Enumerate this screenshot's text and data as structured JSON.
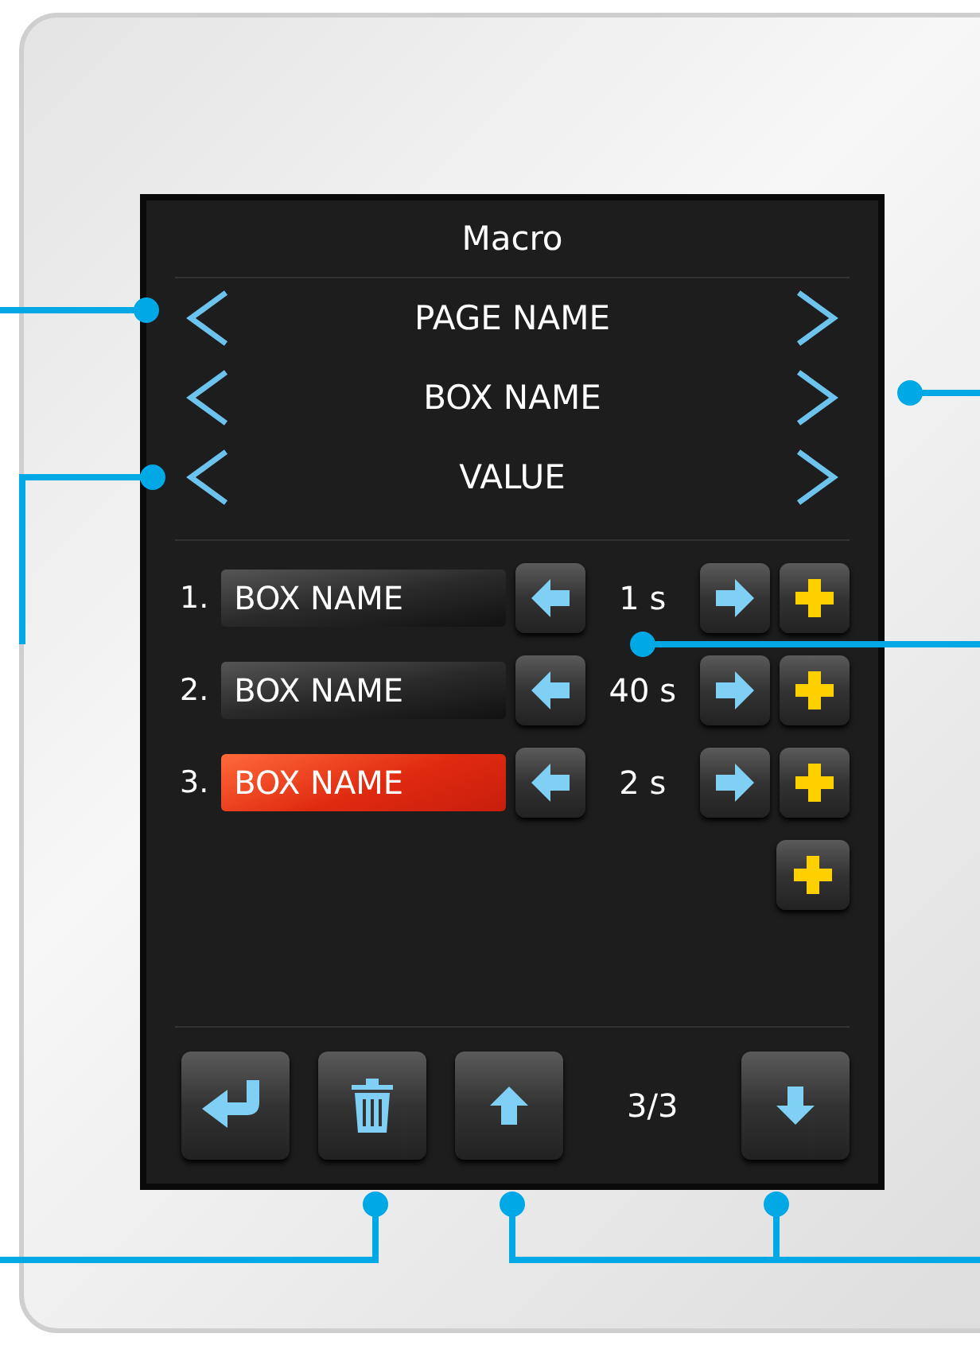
{
  "title": "Macro",
  "selectors": [
    {
      "label": "PAGE NAME"
    },
    {
      "label": "BOX NAME"
    },
    {
      "label": "VALUE"
    }
  ],
  "steps": [
    {
      "index": "1.",
      "name": "BOX NAME",
      "duration": "1 s",
      "selected": false
    },
    {
      "index": "2.",
      "name": "BOX NAME",
      "duration": "40 s",
      "selected": false
    },
    {
      "index": "3.",
      "name": "BOX NAME",
      "duration": "2 s",
      "selected": true
    }
  ],
  "page_indicator": "3/3"
}
